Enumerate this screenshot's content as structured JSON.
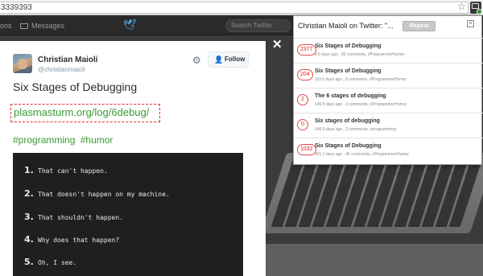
{
  "browser": {
    "url": "3339393"
  },
  "twitter_nav": {
    "home_label": "ons",
    "messages_label": "Messages",
    "search_placeholder": "Search Twitter"
  },
  "tweet": {
    "author_name": "Christian Maioli",
    "author_handle": "@christianmaioli",
    "follow_label": "Follow",
    "text": "Six Stages of Debugging",
    "link": "plasmasturm.org/log/6debug/",
    "hashtags": [
      "#programming",
      "#humor"
    ],
    "image_lines": [
      {
        "num": "1.",
        "text": "That can't happen."
      },
      {
        "num": "2.",
        "text": "That doesn't happen on my machine."
      },
      {
        "num": "3.",
        "text": "That shouldn't happen."
      },
      {
        "num": "4.",
        "text": "Why does that happen?"
      },
      {
        "num": "5.",
        "text": "Oh, I see."
      }
    ]
  },
  "popup": {
    "title": "Christian Maioli on Twitter: \"...",
    "repost_label": "Repost",
    "posts": [
      {
        "score": "2377",
        "title": "Six Stages of Debugging",
        "meta": "0.9 days ago ,  90 comments,  r/ProgrammerHumor"
      },
      {
        "score": "204",
        "title": "Six Stages of Debugging",
        "meta": "110.6 days ago ,  8 comments,  r/ProgrammerHumor"
      },
      {
        "score": "2",
        "title": "The 6 stages of debugging",
        "meta": "146.5 days ago ,  2 comments,  r/ProgrammerHumor"
      },
      {
        "score": "0",
        "title": "Six stages of debugging",
        "meta": "146.5 days ago ,  3 comments,  r/programming"
      },
      {
        "score": "1032",
        "title": "Six Stages of Debugging",
        "meta": "321.2 days ago ,  46 comments,  r/ProgrammerHumor"
      }
    ]
  },
  "colors": {
    "link_green": "#3a9a34",
    "score_red": "#d22",
    "twitter_blue": "#55acee"
  }
}
